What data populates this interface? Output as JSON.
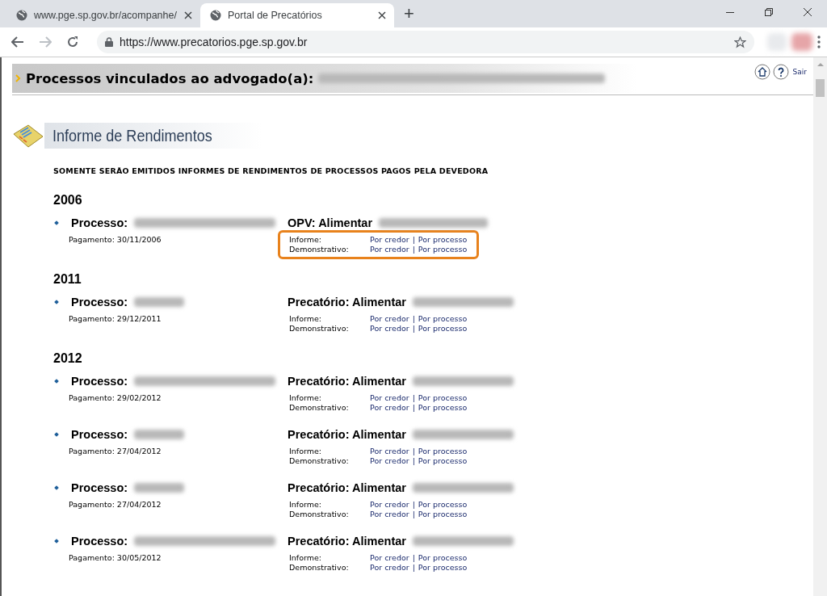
{
  "browser": {
    "tabs": [
      {
        "title": "www.pge.sp.gov.br/acompanhe/",
        "selected": false
      },
      {
        "title": "Portal de Precatórios",
        "selected": true
      }
    ],
    "new_tab": "+",
    "url": "https://www.precatorios.pge.sp.gov.br"
  },
  "header": {
    "title": "Processos vinculados ao advogado(a):",
    "exit": "Sair"
  },
  "section": {
    "title": "Informe de Rendimentos",
    "notice": "SOMENTE SERÃO EMITIDOS INFORMES DE RENDIMENTOS DE PROCESSOS PAGOS PELA DEVEDORA"
  },
  "years": [
    {
      "year": "2006",
      "processes": [
        {
          "label": "Processo:",
          "kind_label": "OPV: Alimentar",
          "payment": "Pagamento: 30/11/2006",
          "highlighted": true,
          "docs": [
            {
              "label": "Informe:",
              "by_creditor": "Por credor",
              "separator": "|",
              "by_process": "Por processo"
            },
            {
              "label": "Demonstrativo:",
              "by_creditor": "Por credor",
              "separator": "|",
              "by_process": "Por processo"
            }
          ]
        }
      ]
    },
    {
      "year": "2011",
      "processes": [
        {
          "label": "Processo:",
          "kind_label": "Precatório: Alimentar",
          "payment": "Pagamento: 29/12/2011",
          "highlighted": false,
          "docs": [
            {
              "label": "Informe:",
              "by_creditor": "Por credor",
              "separator": "|",
              "by_process": "Por processo"
            },
            {
              "label": "Demonstrativo:",
              "by_creditor": "Por credor",
              "separator": "|",
              "by_process": "Por processo"
            }
          ]
        }
      ]
    },
    {
      "year": "2012",
      "processes": [
        {
          "label": "Processo:",
          "kind_label": "Precatório: Alimentar",
          "payment": "Pagamento: 29/02/2012",
          "highlighted": false,
          "docs": [
            {
              "label": "Informe:",
              "by_creditor": "Por credor",
              "separator": "|",
              "by_process": "Por processo"
            },
            {
              "label": "Demonstrativo:",
              "by_creditor": "Por credor",
              "separator": "|",
              "by_process": "Por processo"
            }
          ]
        },
        {
          "label": "Processo:",
          "kind_label": "Precatório: Alimentar",
          "payment": "Pagamento: 27/04/2012",
          "highlighted": false,
          "docs": [
            {
              "label": "Informe:",
              "by_creditor": "Por credor",
              "separator": "|",
              "by_process": "Por processo"
            },
            {
              "label": "Demonstrativo:",
              "by_creditor": "Por credor",
              "separator": "|",
              "by_process": "Por processo"
            }
          ]
        },
        {
          "label": "Processo:",
          "kind_label": "Precatório: Alimentar",
          "payment": "Pagamento: 27/04/2012",
          "highlighted": false,
          "docs": [
            {
              "label": "Informe:",
              "by_creditor": "Por credor",
              "separator": "|",
              "by_process": "Por processo"
            },
            {
              "label": "Demonstrativo:",
              "by_creditor": "Por credor",
              "separator": "|",
              "by_process": "Por processo"
            }
          ]
        },
        {
          "label": "Processo:",
          "kind_label": "Precatório: Alimentar",
          "payment": "Pagamento: 30/05/2012",
          "highlighted": false,
          "docs": [
            {
              "label": "Informe:",
              "by_creditor": "Por credor",
              "separator": "|",
              "by_process": "Por processo"
            },
            {
              "label": "Demonstrativo:",
              "by_creditor": "Por credor",
              "separator": "|",
              "by_process": "Por processo"
            }
          ]
        }
      ]
    }
  ]
}
